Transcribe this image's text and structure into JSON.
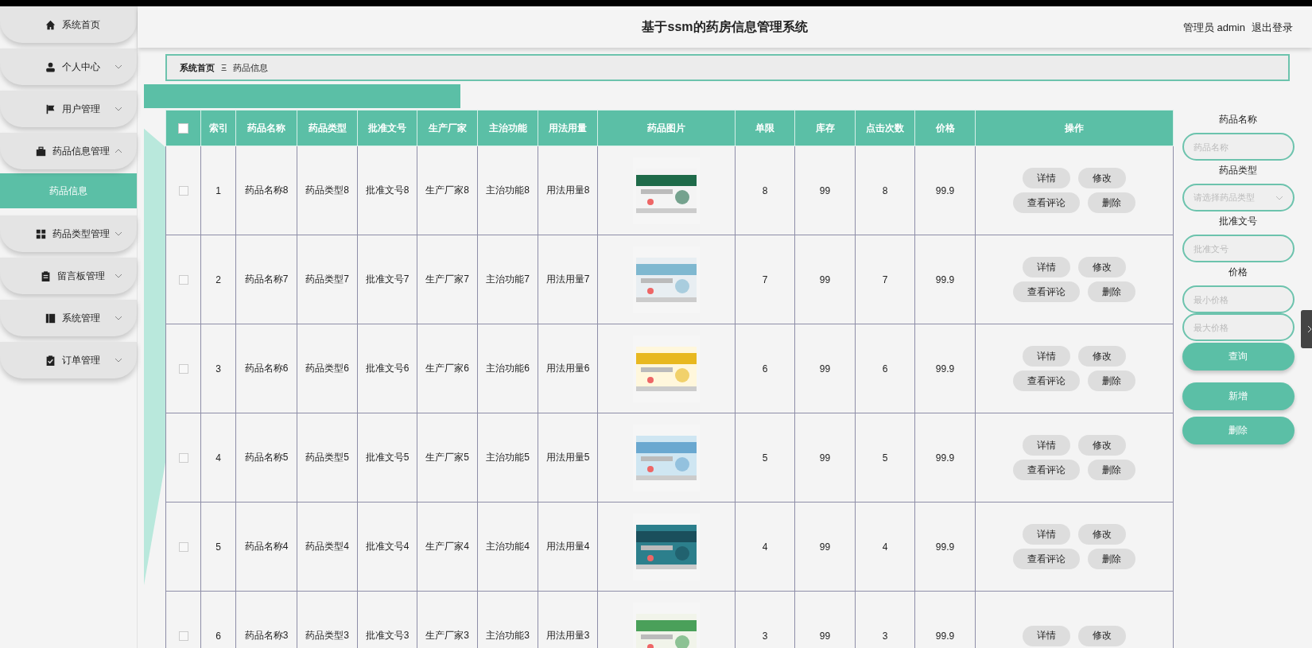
{
  "sidebar": {
    "items": [
      {
        "label": "系统首页",
        "kind": "link"
      },
      {
        "label": "个人中心",
        "kind": "menu",
        "expanded": false
      },
      {
        "label": "用户管理",
        "kind": "menu",
        "expanded": false
      },
      {
        "label": "药品信息管理",
        "kind": "menu",
        "expanded": true,
        "children": [
          {
            "label": "药品信息",
            "selected": true
          }
        ]
      },
      {
        "label": "药品类型管理",
        "kind": "menu",
        "expanded": false
      },
      {
        "label": "留言板管理",
        "kind": "menu",
        "expanded": false
      },
      {
        "label": "系统管理",
        "kind": "menu",
        "expanded": false
      },
      {
        "label": "订单管理",
        "kind": "menu",
        "expanded": false
      }
    ]
  },
  "header": {
    "title": "基于ssm的药房信息管理系统",
    "user": "管理员 admin",
    "logout": "退出登录"
  },
  "breadcrumb": {
    "items": [
      "系统首页",
      "药品信息"
    ],
    "separator": "Ξ"
  },
  "table": {
    "select_all": {
      "checked": false
    },
    "columns": [
      "索引",
      "药品名称",
      "药品类型",
      "批准文号",
      "生产厂家",
      "主治功能",
      "用法用量",
      "药品图片",
      "单限",
      "库存",
      "点击次数",
      "价格",
      "操作"
    ],
    "rows": [
      {
        "checked": false,
        "cells": [
          "1",
          "药品名称8",
          "药品类型8",
          "批准文号8",
          "生产厂家8",
          "主治功能8",
          "用法用量8"
        ],
        "image": {
          "kind": "picture"
        },
        "tail": [
          "8",
          "99",
          "8",
          "99.9"
        ],
        "actions": [
          "详情",
          "修改",
          "查看评论",
          "删除"
        ]
      },
      {
        "checked": false,
        "cells": [
          "2",
          "药品名称7",
          "药品类型7",
          "批准文号7",
          "生产厂家7",
          "主治功能7",
          "用法用量7"
        ],
        "image": {
          "kind": "picture"
        },
        "tail": [
          "7",
          "99",
          "7",
          "99.9"
        ],
        "actions": [
          "详情",
          "修改",
          "查看评论",
          "删除"
        ]
      },
      {
        "checked": false,
        "cells": [
          "3",
          "药品名称6",
          "药品类型6",
          "批准文号6",
          "生产厂家6",
          "主治功能6",
          "用法用量6"
        ],
        "image": {
          "kind": "picture"
        },
        "tail": [
          "6",
          "99",
          "6",
          "99.9"
        ],
        "actions": [
          "详情",
          "修改",
          "查看评论",
          "删除"
        ]
      },
      {
        "checked": false,
        "cells": [
          "4",
          "药品名称5",
          "药品类型5",
          "批准文号5",
          "生产厂家5",
          "主治功能5",
          "用法用量5"
        ],
        "image": {
          "kind": "picture"
        },
        "tail": [
          "5",
          "99",
          "5",
          "99.9"
        ],
        "actions": [
          "详情",
          "修改",
          "查看评论",
          "删除"
        ]
      },
      {
        "checked": false,
        "cells": [
          "5",
          "药品名称4",
          "药品类型4",
          "批准文号4",
          "生产厂家4",
          "主治功能4",
          "用法用量4"
        ],
        "image": {
          "kind": "picture"
        },
        "tail": [
          "4",
          "99",
          "4",
          "99.9"
        ],
        "actions": [
          "详情",
          "修改",
          "查看评论",
          "删除"
        ]
      },
      {
        "checked": false,
        "cells": [
          "6",
          "药品名称3",
          "药品类型3",
          "批准文号3",
          "生产厂家3",
          "主治功能3",
          "用法用量3"
        ],
        "image": {
          "kind": "picture"
        },
        "tail": [
          "3",
          "99",
          "3",
          "99.9"
        ],
        "actions": [
          "详情",
          "修改"
        ]
      }
    ]
  },
  "search": {
    "fields": [
      {
        "label": "药品名称",
        "kind": "input",
        "placeholder": "药品名称"
      },
      {
        "label": "药品类型",
        "kind": "select",
        "placeholder": "请选择药品类型"
      },
      {
        "label": "批准文号",
        "kind": "input",
        "placeholder": "批准文号"
      },
      {
        "label": "价格",
        "kind": "range",
        "placeholder": "最小价格",
        "placeholder_max": "最大价格"
      }
    ],
    "buttons": [
      "查询",
      "新增",
      "删除"
    ]
  }
}
